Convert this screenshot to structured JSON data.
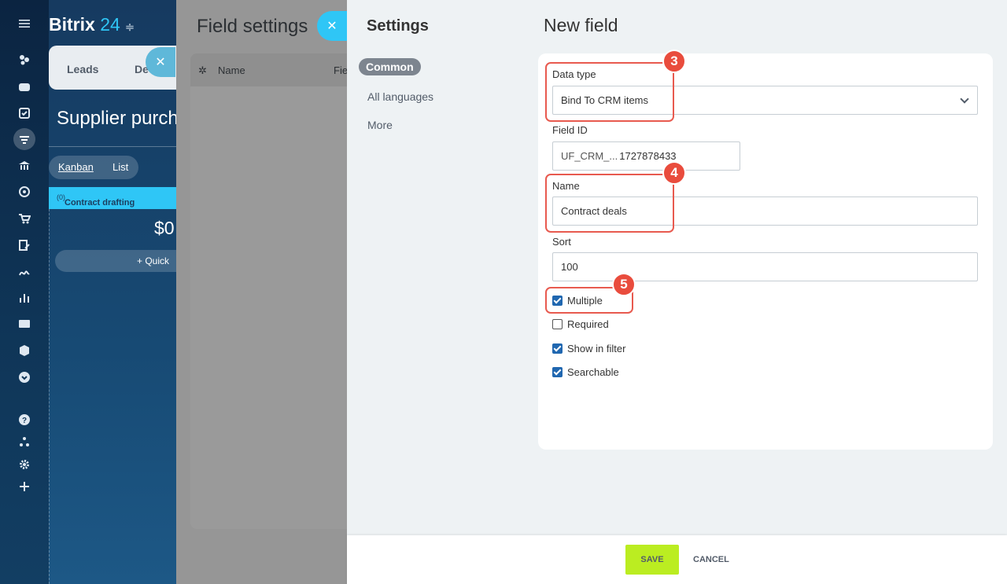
{
  "app": {
    "logo_text": "Bitrix",
    "logo_number": "24",
    "tabs": [
      "Leads",
      "De"
    ],
    "page_title": "Supplier purcha",
    "views": [
      "Kanban",
      "List"
    ],
    "column_title": "Contract drafting",
    "column_count": "(0)",
    "column_sum": "$0",
    "quick_add": "+ Quick"
  },
  "field_settings": {
    "title": "Field settings",
    "columns": [
      "Name",
      "Fie"
    ]
  },
  "settings": {
    "title": "Settings",
    "nav": [
      "Common",
      "All languages",
      "More"
    ],
    "active_nav": "Common"
  },
  "new_field": {
    "title": "New field",
    "data_type_label": "Data type",
    "data_type_value": "Bind To CRM items",
    "field_id_label": "Field ID",
    "field_id_prefix": "UF_CRM_...",
    "field_id_value": "1727878433",
    "name_label": "Name",
    "name_value": "Contract deals",
    "sort_label": "Sort",
    "sort_value": "100",
    "checkboxes": [
      {
        "label": "Multiple",
        "checked": true
      },
      {
        "label": "Required",
        "checked": false
      },
      {
        "label": "Show in filter",
        "checked": true
      },
      {
        "label": "Searchable",
        "checked": true
      }
    ]
  },
  "annotations": [
    "3",
    "4",
    "5"
  ],
  "footer": {
    "save_label": "SAVE",
    "cancel_label": "CANCEL"
  },
  "colors": {
    "annotation": "#e94c3d",
    "save_button": "#bbed21",
    "accent": "#2fc6f6",
    "checkbox": "#2067b0"
  }
}
